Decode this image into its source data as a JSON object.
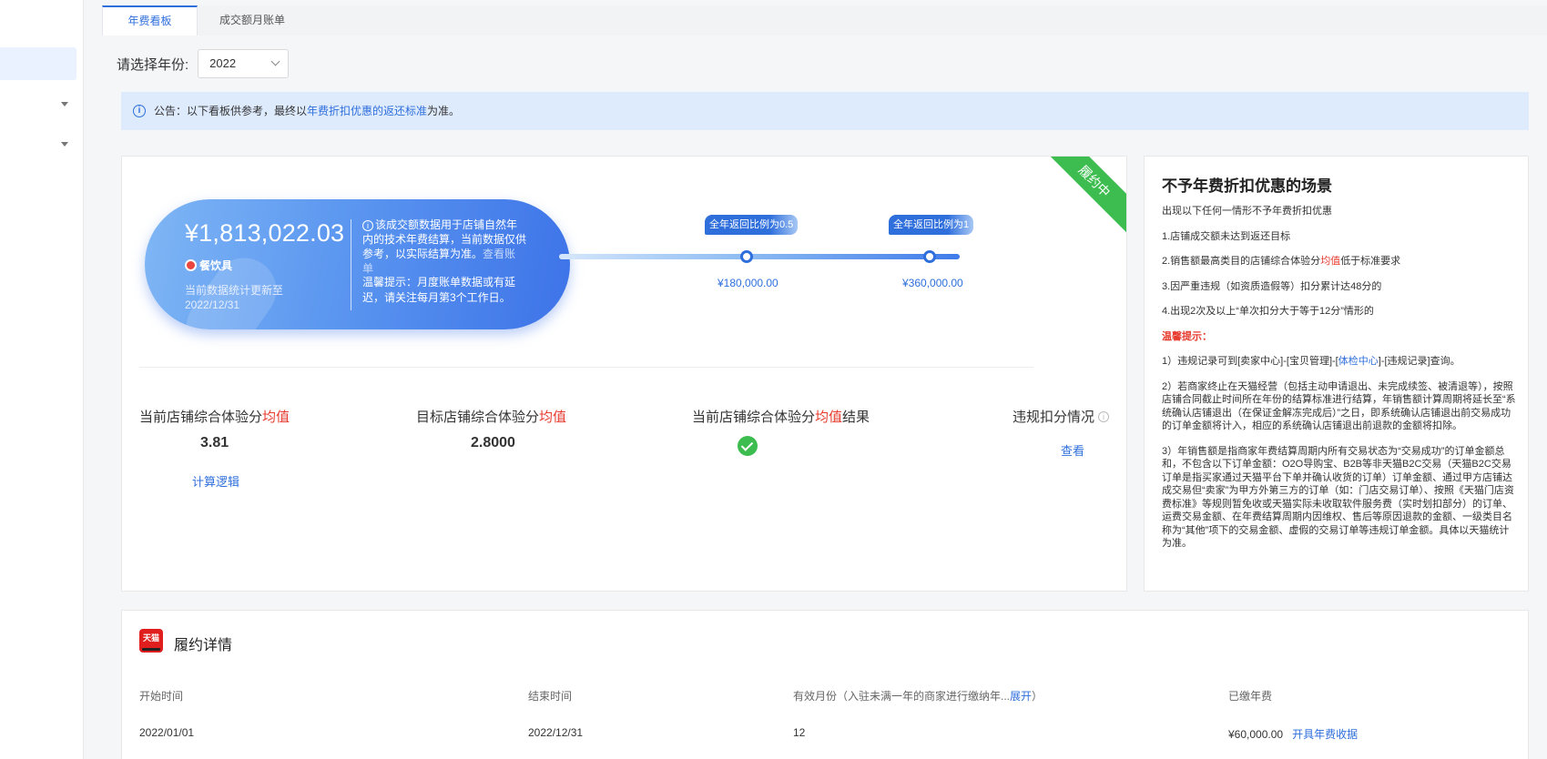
{
  "tabs": [
    "年费看板",
    "成交额月账单"
  ],
  "year_filter": {
    "label": "请选择年份:",
    "value": "2022"
  },
  "notice": {
    "prefix": "公告：以下看板供参考，最终以",
    "link": "年费折扣优惠的返还标准",
    "suffix": "为准。"
  },
  "status_ribbon": "履约中",
  "summary": {
    "amount": "¥1,813,022.03",
    "category": "餐饮具",
    "update_line1": "当前数据统计更新至",
    "update_line2": "2022/12/31",
    "desc": "该成交额数据用于店铺自然年内的技术年费结算，当前数据仅供参考，以实际结算为准。",
    "desc_link": "查看账单",
    "tip": "温馨提示：月度账单数据或有延迟，请关注每月第3个工作日。"
  },
  "progress": {
    "milestones": [
      {
        "badge": "全年返回比例为0.5",
        "value": "¥180,000.00"
      },
      {
        "badge": "全年返回比例为1",
        "value": "¥360,000.00"
      }
    ]
  },
  "metrics": [
    {
      "title": "当前店铺综合体验分",
      "title_red": "均值",
      "title_suffix": "",
      "value": "3.81",
      "link": "计算逻辑"
    },
    {
      "title": "目标店铺综合体验分",
      "title_red": "均值",
      "title_suffix": "",
      "value": "2.8000"
    },
    {
      "title": "当前店铺综合体验分",
      "title_red": "均值",
      "title_suffix": "结果",
      "status": "check"
    },
    {
      "title": "违规扣分情况",
      "link": "查看"
    }
  ],
  "rules": {
    "title": "不予年费折扣优惠的场景",
    "intro": "出现以下任何一情形不予年费折扣优惠",
    "items": [
      "1.店铺成交额未达到返还目标",
      "2.销售额最高类目的店铺综合体验分",
      "3.因严重违规（如资质造假等）扣分累计达48分的",
      "4.出现2次及以上“单次扣分大于等于12分”情形的"
    ],
    "item2_red": "均值",
    "item2_suffix": "低于标准要求",
    "warm_title": "温馨提示：",
    "note1_a": "1）违规记录可到[卖家中心]-[宝贝管理]-[",
    "note1_link": "体检中心",
    "note1_b": "]-[违规记录]查询。",
    "note2": "2）若商家终止在天猫经营（包括主动申请退出、未完成续签、被清退等），按照店铺合同截止时间所在年份的结算标准进行结算，年销售额计算周期将延长至“系统确认店铺退出（在保证金解冻完成后）”之日，即系统确认店铺退出前交易成功的订单金额将计入，相应的系统确认店铺退出前退款的金额将扣除。",
    "note3": "3）年销售额是指商家年费结算周期内所有交易状态为“交易成功”的订单金额总和，不包含以下订单金额：O2O导购宝、B2B等非天猫B2C交易（天猫B2C交易订单是指买家通过天猫平台下单并确认收货的订单）订单金额、通过甲方店铺达成交易但“卖家”为甲方外第三方的订单（如：门店交易订单）、按照《天猫门店资费标准》等规则暂免收或天猫实际未收取软件服务费（实时划扣部分）的订单、运费交易金额、在年费结算周期内因维权、售后等原因退款的金额、一级类目名称为“其他”项下的交易金额、虚假的交易订单等违规订单金额。具体以天猫统计为准。"
  },
  "detail": {
    "logo_text": "天猫",
    "title": "履约详情",
    "columns": [
      "开始时间",
      "结束时间",
      "有效月份（入驻未满一年的商家进行缴纳年...",
      "已缴年费"
    ],
    "expand": "展开",
    "col3_close": "）",
    "row": {
      "start": "2022/01/01",
      "end": "2022/12/31",
      "months": "12",
      "paid": "¥60,000.00",
      "invoice": "开具年费收据"
    }
  }
}
